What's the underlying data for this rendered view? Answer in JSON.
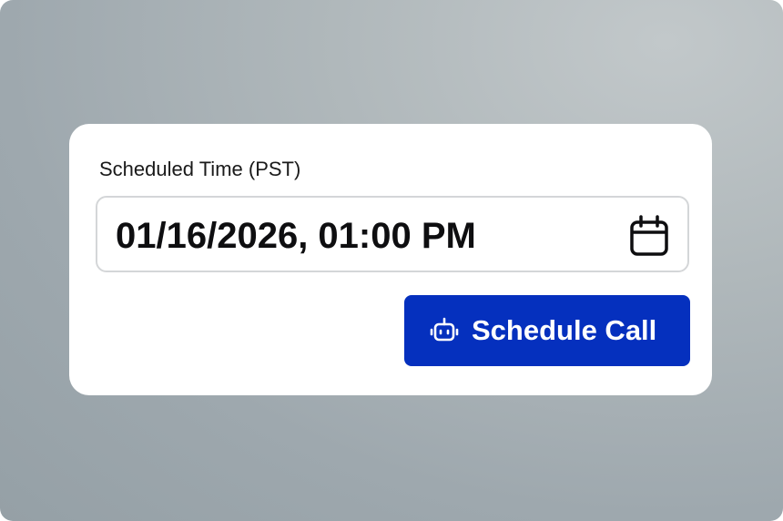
{
  "schedule_form": {
    "label": "Scheduled Time (PST)",
    "datetime_value": "01/16/2026, 01:00 PM",
    "calendar_icon": "calendar-icon",
    "button": {
      "label": "Schedule Call",
      "icon": "bot-icon",
      "color": "#0530be"
    }
  }
}
